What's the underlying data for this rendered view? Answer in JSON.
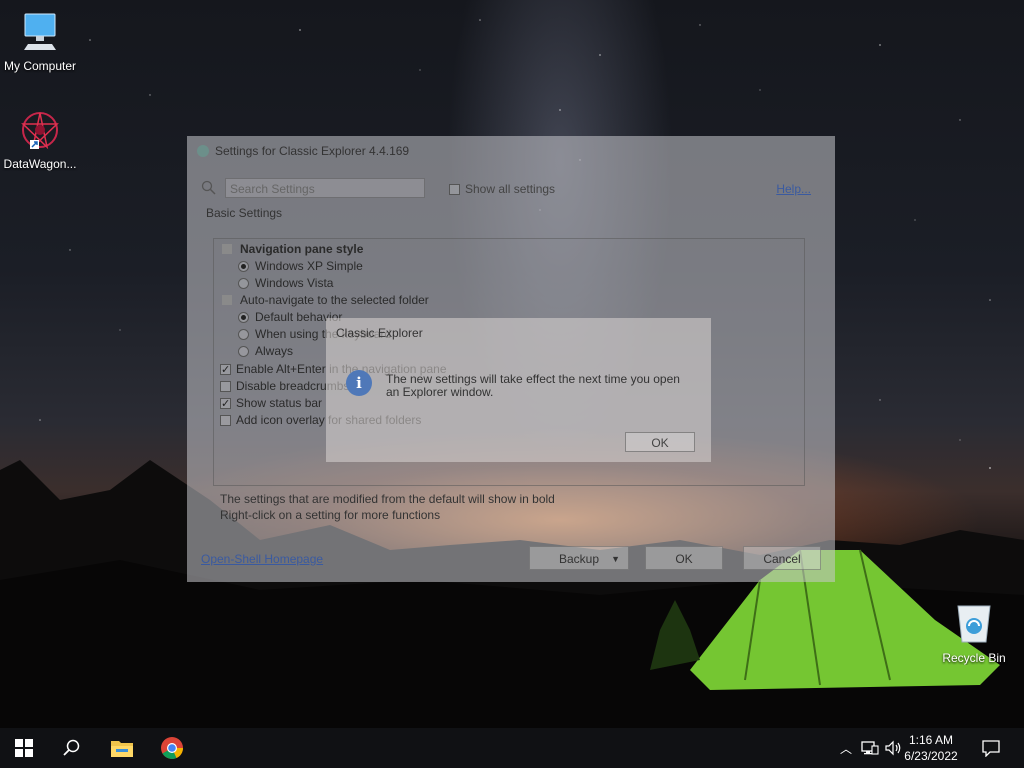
{
  "desktop": {
    "icons": [
      {
        "label": "My Computer",
        "icon": "monitor-icon"
      },
      {
        "label": "DataWagon...",
        "icon": "datawagon-icon"
      },
      {
        "label": "Recycle Bin",
        "icon": "recycle-bin-icon"
      }
    ]
  },
  "settings_window": {
    "title": "Settings for Classic Explorer 4.4.169",
    "search_placeholder": "Search Settings",
    "show_all_label": "Show all settings",
    "show_all_checked": false,
    "help_label": "Help...",
    "tab_label": "Basic Settings",
    "items": [
      {
        "text": "Navigation pane style",
        "kind": "group"
      },
      {
        "text": "Windows XP Simple",
        "kind": "radio",
        "checked": true
      },
      {
        "text": "Windows Vista",
        "kind": "radio",
        "checked": false
      },
      {
        "text": "Auto-navigate to the selected folder",
        "kind": "group"
      },
      {
        "text": "Default behavior",
        "kind": "radio",
        "checked": true
      },
      {
        "text": "When using the keyboard",
        "kind": "radio",
        "checked": false
      },
      {
        "text": "Always",
        "kind": "radio",
        "checked": false
      },
      {
        "text": "Enable Alt+Enter in the navigation pane",
        "kind": "checkbox",
        "checked": true
      },
      {
        "text": "Disable breadcrumbs",
        "kind": "checkbox",
        "checked": false
      },
      {
        "text": "Show status bar",
        "kind": "checkbox",
        "checked": true
      },
      {
        "text": "Add icon overlay for shared folders",
        "kind": "checkbox",
        "checked": false
      }
    ],
    "footnote_1": "The settings that are modified from the default will show in bold",
    "footnote_2": "Right-click on a setting for more functions",
    "homepage_link": "Open-Shell Homepage",
    "backup_label": "Backup",
    "ok_label": "OK",
    "cancel_label": "Cancel"
  },
  "message_box": {
    "title": "Classic Explorer",
    "message": "The new settings will take effect the next time you open an Explorer window.",
    "ok_label": "OK"
  },
  "taskbar": {
    "apps": [
      "start-icon",
      "search-icon",
      "file-explorer-icon",
      "chrome-icon"
    ],
    "time": "1:16 AM",
    "date": "6/23/2022"
  }
}
